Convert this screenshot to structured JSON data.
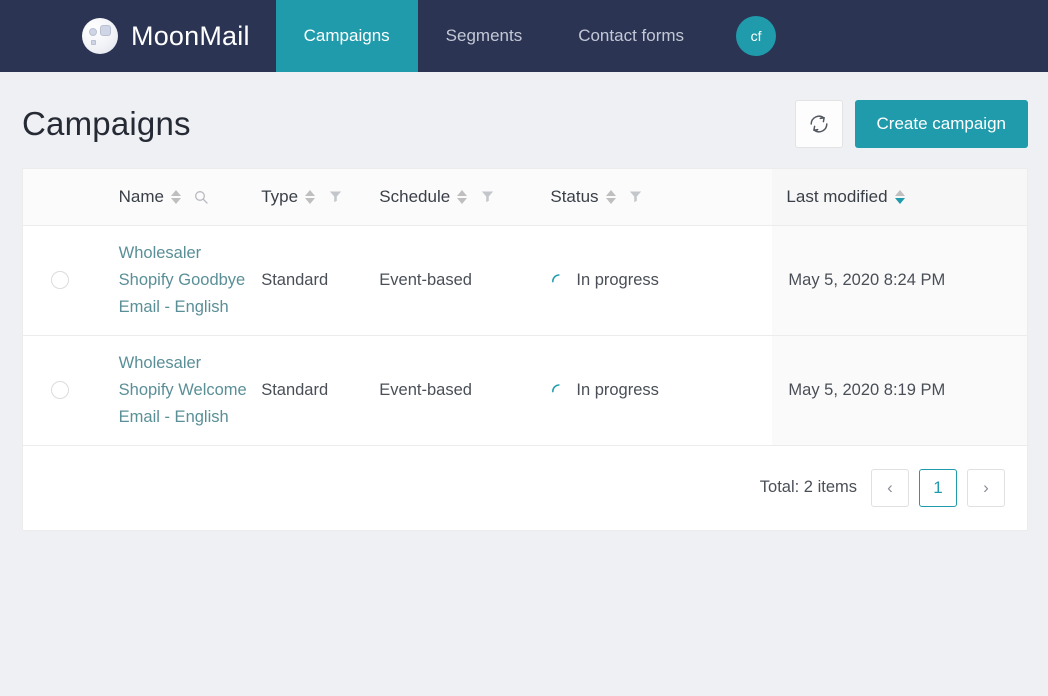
{
  "nav": {
    "brand": "MoonMail",
    "logo_icon": "moon-icon",
    "items": [
      {
        "label": "Campaigns",
        "active": true
      },
      {
        "label": "Segments",
        "active": false
      },
      {
        "label": "Contact forms",
        "active": false
      }
    ],
    "avatar_initials": "cf"
  },
  "page": {
    "title": "Campaigns",
    "refresh_icon": "refresh-icon",
    "create_button": "Create campaign"
  },
  "table": {
    "columns": [
      {
        "key": "name",
        "label": "Name",
        "sort": "none",
        "tool": "search-icon"
      },
      {
        "key": "type",
        "label": "Type",
        "sort": "none",
        "tool": "filter-icon"
      },
      {
        "key": "schedule",
        "label": "Schedule",
        "sort": "none",
        "tool": "filter-icon"
      },
      {
        "key": "status",
        "label": "Status",
        "sort": "none",
        "tool": "filter-icon"
      },
      {
        "key": "last_modified",
        "label": "Last modified",
        "sort": "desc",
        "tool": "none"
      }
    ],
    "rows": [
      {
        "selected": false,
        "name": "Wholesaler Shopify Goodbye Email - English",
        "type": "Standard",
        "schedule": "Event-based",
        "status": "In progress",
        "status_icon": "spinner-icon",
        "last_modified": "May 5, 2020 8:24 PM"
      },
      {
        "selected": false,
        "name": "Wholesaler Shopify Welcome Email - English",
        "type": "Standard",
        "schedule": "Event-based",
        "status": "In progress",
        "status_icon": "spinner-icon",
        "last_modified": "May 5, 2020 8:19 PM"
      }
    ]
  },
  "footer": {
    "total": "Total: 2 items",
    "prev": "‹",
    "page_current": "1",
    "next": "›"
  },
  "colors": {
    "header_bg": "#2b3553",
    "accent": "#1f9bac",
    "page_bg": "#eff0f4",
    "link": "#5a8f97"
  }
}
